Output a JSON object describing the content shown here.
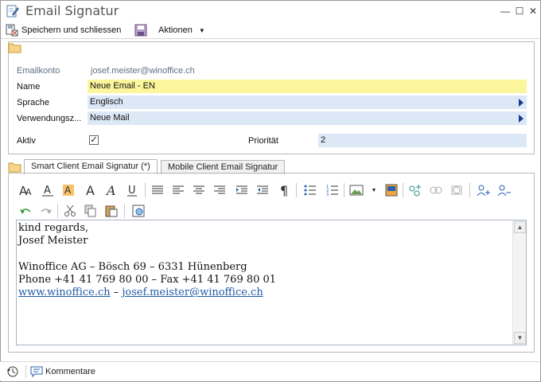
{
  "window": {
    "title": "Email Signatur"
  },
  "toolbar": {
    "save_close_label": "Speichern und schliessen",
    "actions_label": "Aktionen"
  },
  "form": {
    "emailkonto_label": "Emailkonto",
    "emailkonto_value": "josef.meister@winoffice.ch",
    "name_label": "Name",
    "name_value": "Neue Email - EN",
    "sprache_label": "Sprache",
    "sprache_value": "Englisch",
    "verwendung_label": "Verwendungsz...",
    "verwendung_value": "Neue Mail",
    "aktiv_label": "Aktiv",
    "aktiv_checked": true,
    "prioritaet_label": "Priorität",
    "prioritaet_value": "2"
  },
  "tabs": [
    {
      "label": "Smart Client Email Signatur (*)",
      "active": true
    },
    {
      "label": "Mobile Client Email Signatur",
      "active": false
    }
  ],
  "editor": {
    "line1": "kind regards,",
    "line2": "Josef Meister",
    "line3": "Winoffice AG – Bösch 69 – 6331 Hünenberg",
    "line4": "Phone +41 41 769 80 00 – Fax +41 41 769 80 01",
    "link1": "www.winoffice.ch",
    "link_sep": " – ",
    "link2": "josef.meister@winoffice.ch"
  },
  "statusbar": {
    "comments_label": "Kommentare"
  },
  "colors": {
    "field_bg": "#dde8f7",
    "name_field_bg": "#fbf59b",
    "link": "#1f5aa8"
  }
}
